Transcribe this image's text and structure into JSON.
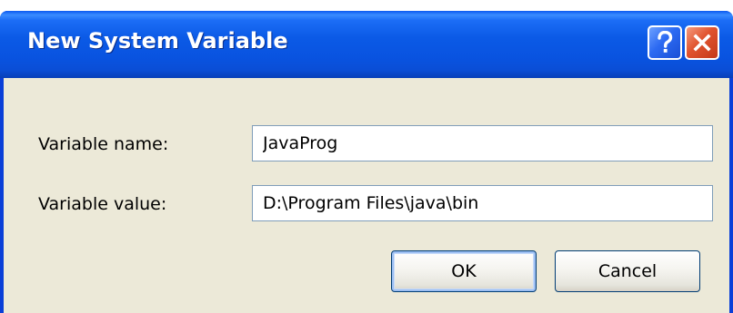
{
  "dialog": {
    "title": "New System Variable",
    "help_icon": "help-icon",
    "close_icon": "close-icon"
  },
  "form": {
    "name_label": "Variable name:",
    "name_value": "JavaProg",
    "value_label": "Variable value:",
    "value_value": "D:\\Program Files\\java\\bin"
  },
  "buttons": {
    "ok_label": "OK",
    "cancel_label": "Cancel"
  },
  "colors": {
    "titlebar": "#0a58f0",
    "client": "#ece9d8",
    "close_button": "#e0532e",
    "help_button": "#2c6af2"
  }
}
